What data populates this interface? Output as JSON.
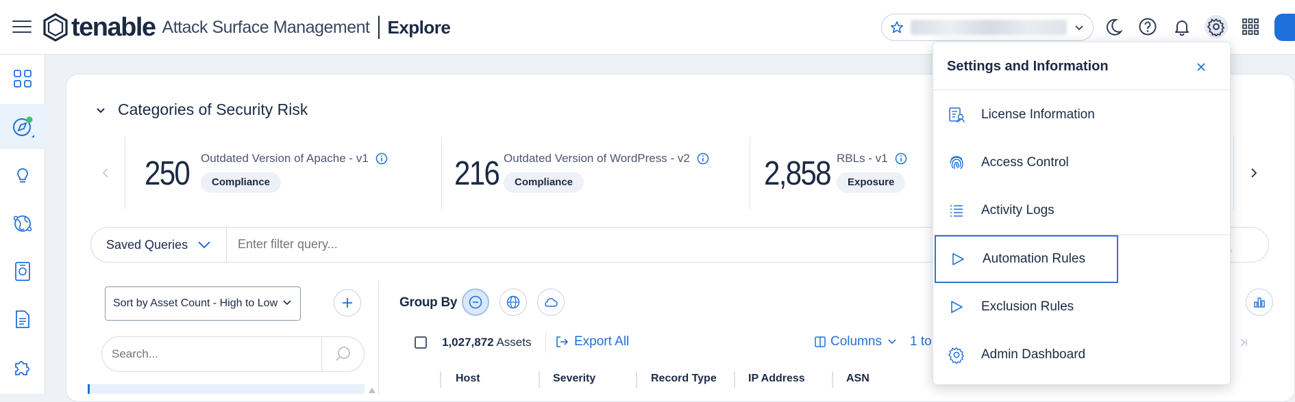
{
  "header": {
    "logo_text": "tenable",
    "product_name": "Attack Surface Management",
    "page_name": "Explore"
  },
  "icons": {
    "topbar": [
      "menu-icon",
      "star-icon",
      "chevron-down-icon",
      "moon-icon",
      "help-icon",
      "bell-icon",
      "gear-icon",
      "apps-grid-icon"
    ],
    "sidenav": [
      "dashboard-icon",
      "explore-compass-icon",
      "insights-bulb-icon",
      "globe-network-icon",
      "reports-icon",
      "document-icon",
      "integrations-puzzle-icon"
    ]
  },
  "colors": {
    "accent": "#1f6fd8",
    "text": "#1b2a44",
    "status_dot": "#3cc46a"
  },
  "section": {
    "title": "Categories of Security Risk"
  },
  "risk_cards": [
    {
      "count": "250",
      "name": "Outdated Version of Apache - v1",
      "badge": "Compliance"
    },
    {
      "count": "216",
      "name": "Outdated Version of WordPress - v2",
      "badge": "Compliance"
    },
    {
      "count": "2,858",
      "name": "RBLs - v1",
      "badge": "Exposure"
    }
  ],
  "query": {
    "saved_label": "Saved Queries",
    "placeholder": "Enter filter query..."
  },
  "left_panel": {
    "sort_label": "Sort by Asset Count - High to Low",
    "search_placeholder": "Search..."
  },
  "results": {
    "group_by_label": "Group By",
    "asset_count": "1,027,872",
    "assets_word": "Assets",
    "export_label": "Export All",
    "columns_label": "Columns",
    "range_label": "1 to",
    "columns": [
      "Host",
      "Severity",
      "Record Type",
      "IP Address",
      "ASN"
    ]
  },
  "settings_panel": {
    "title": "Settings and Information",
    "items": [
      {
        "label": "License Information",
        "icon": "license-icon"
      },
      {
        "label": "Access Control",
        "icon": "fingerprint-icon"
      },
      {
        "label": "Activity Logs",
        "icon": "list-icon"
      },
      {
        "label": "Automation Rules",
        "icon": "play-outline-icon"
      },
      {
        "label": "Exclusion Rules",
        "icon": "play-outline-icon"
      },
      {
        "label": "Admin Dashboard",
        "icon": "gear-icon"
      }
    ]
  }
}
